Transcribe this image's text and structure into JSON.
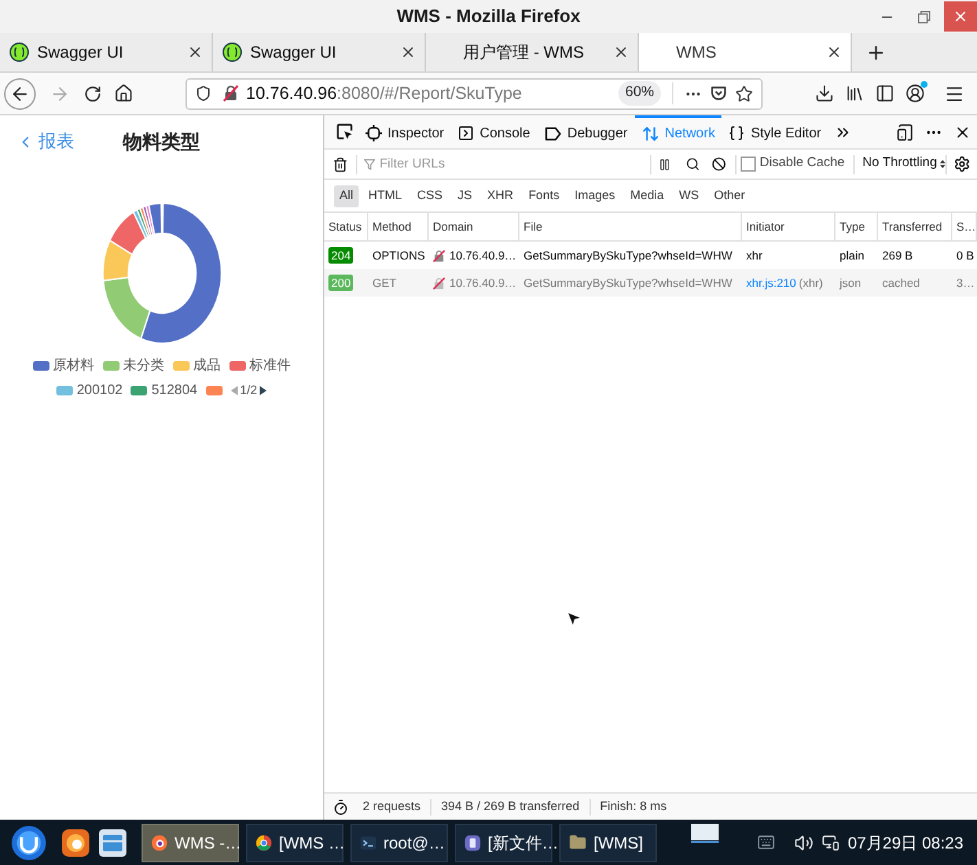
{
  "window": {
    "title": "WMS - Mozilla Firefox"
  },
  "tabs": [
    {
      "label": "Swagger UI",
      "kind": "swagger",
      "selected": false
    },
    {
      "label": "Swagger UI",
      "kind": "swagger",
      "selected": false
    },
    {
      "label": "用户管理 - WMS",
      "kind": "blank",
      "selected": false
    },
    {
      "label": "WMS",
      "kind": "blank",
      "selected": true
    }
  ],
  "address_bar": {
    "host": "10.76.40.96",
    "path": ":8080/#/Report/SkuType",
    "zoom": "60%"
  },
  "page": {
    "back_link": "报表",
    "title": "物料类型",
    "legend": [
      {
        "label": "原材料",
        "color": "#5470c6"
      },
      {
        "label": "未分类",
        "color": "#91cc75"
      },
      {
        "label": "成品",
        "color": "#fac858"
      },
      {
        "label": "标准件",
        "color": "#ee6666"
      },
      {
        "label": "200102",
        "color": "#73c0de"
      },
      {
        "label": "512804",
        "color": "#3ba272"
      },
      {
        "color": "#fc8452"
      }
    ],
    "legend_page": "1/2"
  },
  "devtools": {
    "tools": [
      {
        "label": "Inspector",
        "kind": "inspector",
        "selected": false
      },
      {
        "label": "Console",
        "kind": "console",
        "selected": false
      },
      {
        "label": "Debugger",
        "kind": "debugger",
        "selected": false
      },
      {
        "label": "Network",
        "kind": "network",
        "selected": true
      },
      {
        "label": "Style Editor",
        "kind": "style",
        "selected": false
      }
    ],
    "filter": {
      "placeholder": "Filter URLs"
    },
    "disable_cache": {
      "label": "Disable Cache",
      "checked": false
    },
    "throttling": "No Throttling",
    "type_filters": [
      {
        "label": "All",
        "selected": true
      },
      {
        "label": "HTML",
        "selected": false
      },
      {
        "label": "CSS",
        "selected": false
      },
      {
        "label": "JS",
        "selected": false
      },
      {
        "label": "XHR",
        "selected": false
      },
      {
        "label": "Fonts",
        "selected": false
      },
      {
        "label": "Images",
        "selected": false
      },
      {
        "label": "Media",
        "selected": false
      },
      {
        "label": "WS",
        "selected": false
      },
      {
        "label": "Other",
        "selected": false
      }
    ],
    "columns": [
      "Status",
      "Method",
      "Domain",
      "File",
      "Initiator",
      "Type",
      "Transferred",
      "S…"
    ],
    "requests": [
      {
        "status": "204",
        "cached": false,
        "method": "OPTIONS",
        "domain": "10.76.40.9…",
        "file": "GetSummaryBySkuType?whseId=WHW",
        "initiator": {
          "kind": "text",
          "label": "xhr"
        },
        "type": "plain",
        "transferred": "269 B",
        "size": "0 B"
      },
      {
        "status": "200",
        "cached": true,
        "method": "GET",
        "domain": "10.76.40.9…",
        "file": "GetSummaryBySkuType?whseId=WHW",
        "initiator": {
          "kind": "link",
          "label": "xhr.js:210",
          "note": "(xhr)"
        },
        "type": "json",
        "transferred": "cached",
        "size": "3…"
      }
    ],
    "summary": {
      "requests": "2 requests",
      "transferred": "394 B / 269 B transferred",
      "finish": "Finish: 8 ms"
    }
  },
  "taskbar": {
    "tasks": [
      {
        "label": "WMS -…",
        "kind": "firefox",
        "selected": true
      },
      {
        "label": "[WMS …",
        "kind": "chrome",
        "selected": false
      },
      {
        "label": "root@…",
        "kind": "terminal",
        "selected": false
      },
      {
        "label": "[新文件…",
        "kind": "editor",
        "selected": false
      },
      {
        "label": "[WMS]",
        "kind": "folder",
        "selected": false
      }
    ],
    "clock": "07月29日 08:23"
  }
}
